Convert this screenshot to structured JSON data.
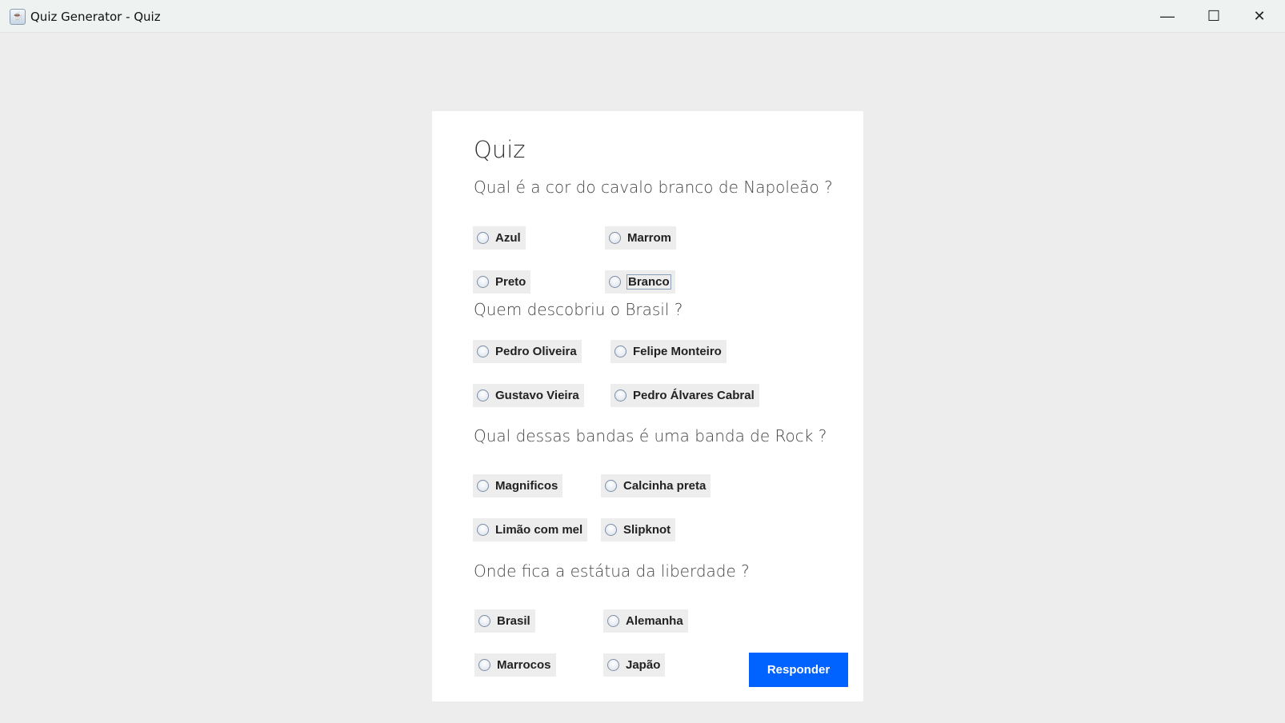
{
  "window": {
    "title": "Quiz Generator - Quiz",
    "minimize": "—",
    "maximize": "☐",
    "close": "✕"
  },
  "quiz": {
    "heading": "Quiz",
    "questions": [
      {
        "text": "Qual é a cor do cavalo branco de Napoleão ?",
        "options": [
          "Azul",
          "Marrom",
          "Preto",
          "Branco"
        ],
        "focused": 3
      },
      {
        "text": "Quem descobriu o Brasil ?",
        "options": [
          "Pedro Oliveira",
          "Felipe Monteiro",
          "Gustavo Vieira",
          "Pedro Álvares Cabral"
        ],
        "focused": -1
      },
      {
        "text": "Qual dessas bandas é uma banda de Rock ?",
        "options": [
          "Magnificos",
          "Calcinha preta",
          "Limão com mel",
          "Slipknot"
        ],
        "focused": -1
      },
      {
        "text": "Onde fica a estátua da liberdade ?",
        "options": [
          "Brasil",
          "Alemanha",
          "Marrocos",
          "Japão"
        ],
        "focused": -1
      }
    ],
    "submit_label": "Responder"
  }
}
